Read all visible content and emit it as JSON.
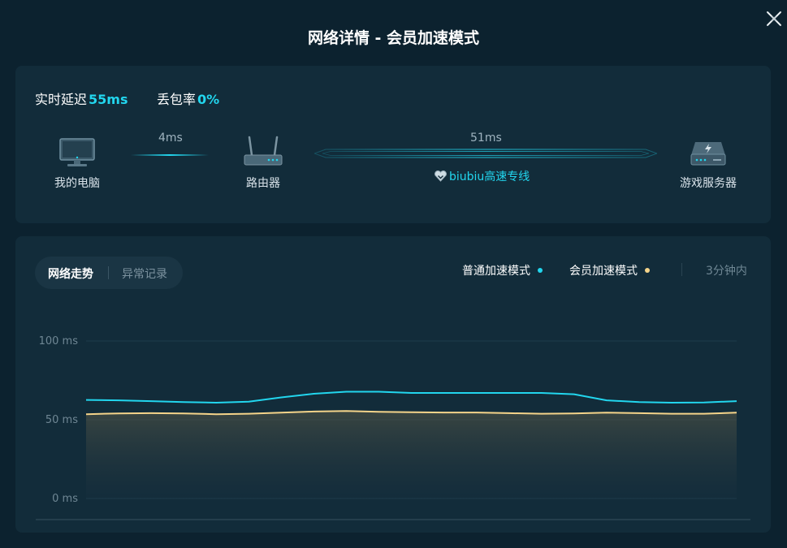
{
  "dialog": {
    "title": "网络详情 - 会员加速模式"
  },
  "stats": {
    "latency_label": "实时延迟",
    "latency_value": "55ms",
    "loss_label": "丢包率",
    "loss_value": "0%"
  },
  "path": {
    "pc_label": "我的电脑",
    "router_label": "路由器",
    "server_label": "游戏服务器",
    "hop1_ms": "4ms",
    "hop2_ms": "51ms",
    "line_name": "biubiu高速专线"
  },
  "chart_panel": {
    "tab_active": "网络走势",
    "tab_inactive": "异常记录",
    "legend_normal": "普通加速模式",
    "legend_member": "会员加速模式",
    "time_range": "3分钟内",
    "color_normal": "#22d6ee",
    "color_member": "#f5d48a"
  },
  "chart_data": {
    "type": "line",
    "title": "",
    "xlabel": "",
    "ylabel": "",
    "ylim": [
      0,
      100
    ],
    "y_ticks": [
      "100 ms",
      "50 ms",
      "0 ms"
    ],
    "x": [
      0,
      10,
      20,
      30,
      40,
      50,
      60,
      70,
      80,
      90,
      100,
      110,
      120,
      130,
      140,
      150,
      160,
      170,
      180,
      190,
      200
    ],
    "series": [
      {
        "name": "普通加速模式",
        "color": "#22d6ee",
        "values": [
          62.6,
          62.3,
          61.8,
          61.2,
          60.8,
          61.5,
          64.2,
          66.5,
          67.8,
          67.8,
          67.0,
          67.0,
          67.0,
          67.0,
          67.0,
          66.2,
          62.3,
          61.2,
          60.8,
          61.0,
          61.8
        ]
      },
      {
        "name": "会员加速模式",
        "color": "#f5d48a",
        "values": [
          53.5,
          54.0,
          54.2,
          54.0,
          53.5,
          53.8,
          54.5,
          55.2,
          55.5,
          55.0,
          54.8,
          54.6,
          54.6,
          54.2,
          53.8,
          54.0,
          54.5,
          54.2,
          53.8,
          53.8,
          54.5
        ]
      }
    ]
  }
}
